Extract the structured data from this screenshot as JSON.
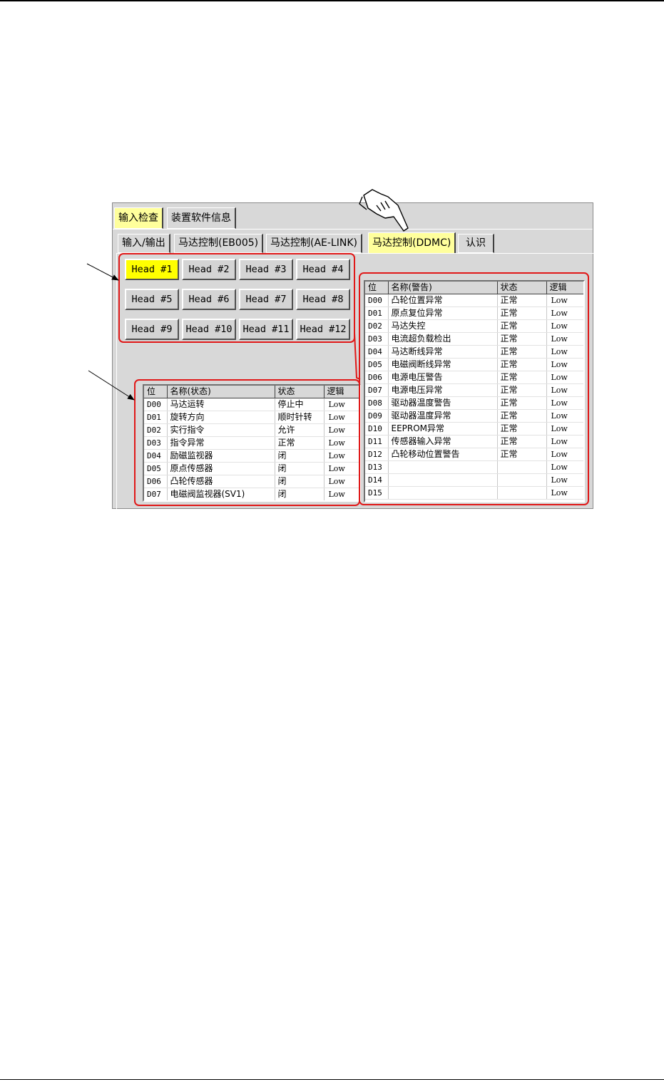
{
  "tabs_top": [
    "输入检查",
    "装置软件信息"
  ],
  "tabs_sub": [
    "输入/输出",
    "马达控制(EB005)",
    "马达控制(AE-LINK)",
    "马达控制(DDMC)",
    "认识"
  ],
  "heads": [
    "Head #1",
    "Head #2",
    "Head #3",
    "Head #4",
    "Head #5",
    "Head #6",
    "Head #7",
    "Head #8",
    "Head #9",
    "Head #10",
    "Head #11",
    "Head #12"
  ],
  "status_table": {
    "headers": [
      "位",
      "名称(状态)",
      "状态",
      "逻辑"
    ],
    "rows": [
      [
        "D00",
        "马达运转",
        "停止中",
        "Low"
      ],
      [
        "D01",
        "旋转方向",
        "顺时针转",
        "Low"
      ],
      [
        "D02",
        "实行指令",
        "允许",
        "Low"
      ],
      [
        "D03",
        "指令异常",
        "正常",
        "Low"
      ],
      [
        "D04",
        "励磁监视器",
        "闭",
        "Low"
      ],
      [
        "D05",
        "原点传感器",
        "闭",
        "Low"
      ],
      [
        "D06",
        "凸轮传感器",
        "闭",
        "Low"
      ],
      [
        "D07",
        "电磁阀监视器(SV1)",
        "闭",
        "Low"
      ]
    ]
  },
  "warning_table": {
    "headers": [
      "位",
      "名称(警告)",
      "状态",
      "逻辑"
    ],
    "rows": [
      [
        "D00",
        "凸轮位置异常",
        "正常",
        "Low"
      ],
      [
        "D01",
        "原点复位异常",
        "正常",
        "Low"
      ],
      [
        "D02",
        "马达失控",
        "正常",
        "Low"
      ],
      [
        "D03",
        "电流超负载检出",
        "正常",
        "Low"
      ],
      [
        "D04",
        "马达断线异常",
        "正常",
        "Low"
      ],
      [
        "D05",
        "电磁阀断线异常",
        "正常",
        "Low"
      ],
      [
        "D06",
        "电源电压警告",
        "正常",
        "Low"
      ],
      [
        "D07",
        "电源电压异常",
        "正常",
        "Low"
      ],
      [
        "D08",
        "驱动器温度警告",
        "正常",
        "Low"
      ],
      [
        "D09",
        "驱动器温度异常",
        "正常",
        "Low"
      ],
      [
        "D10",
        "EEPROM异常",
        "正常",
        "Low"
      ],
      [
        "D11",
        "传感器输入异常",
        "正常",
        "Low"
      ],
      [
        "D12",
        "凸轮移动位置警告",
        "正常",
        "Low"
      ],
      [
        "D13",
        "",
        "",
        "Low"
      ],
      [
        "D14",
        "",
        "",
        "Low"
      ],
      [
        "D15",
        "",
        "",
        "Low"
      ]
    ]
  },
  "colors": {
    "active_tab": "#ffff9c",
    "selected_head": "#ffff00",
    "highlight": "#e01818"
  },
  "icons": {
    "pointer": "pointing-hand-icon"
  }
}
